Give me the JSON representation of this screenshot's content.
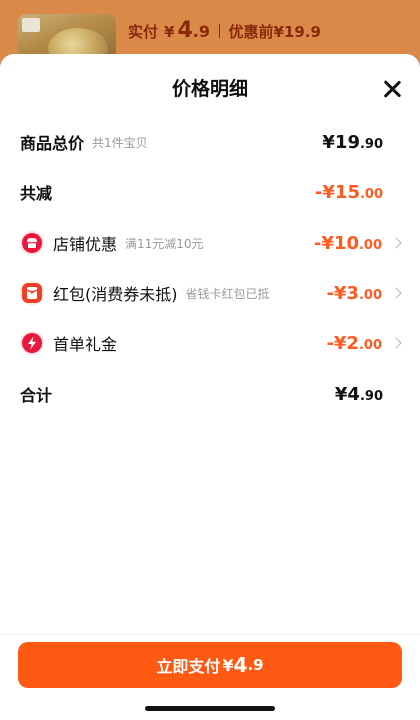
{
  "header": {
    "pay_label": "实付",
    "yen": "¥",
    "pay_int": "4",
    "pay_dec": ".9",
    "orig_label": "优惠前¥19.9"
  },
  "sheet": {
    "title": "价格明细"
  },
  "rows": {
    "total": {
      "label": "商品总价",
      "sub": "共1件宝贝",
      "amount_int": "¥19",
      "amount_dec": ".90"
    },
    "reduce": {
      "label": "共减",
      "amount_int": "-¥15",
      "amount_dec": ".00"
    },
    "store": {
      "label": "店铺优惠",
      "sub": "满11元减10元",
      "amount_int": "-¥10",
      "amount_dec": ".00",
      "icon": "store-icon"
    },
    "redpacket": {
      "label": "红包(消费券未抵)",
      "sub": "省钱卡红包已抵",
      "amount_int": "-¥3",
      "amount_dec": ".00",
      "icon": "red-packet-icon"
    },
    "firstorder": {
      "label": "首单礼金",
      "amount_int": "-¥2",
      "amount_dec": ".00",
      "icon": "lightning-icon"
    },
    "subtotal": {
      "label": "合计",
      "amount_int": "¥4",
      "amount_dec": ".90"
    }
  },
  "pay_button": {
    "label": "立即支付",
    "yen": "¥",
    "int": "4",
    "dec": ".9"
  },
  "colors": {
    "accent": "#ff5a14",
    "discount": "#ff5a1f",
    "icon_red": "#e8173b"
  }
}
